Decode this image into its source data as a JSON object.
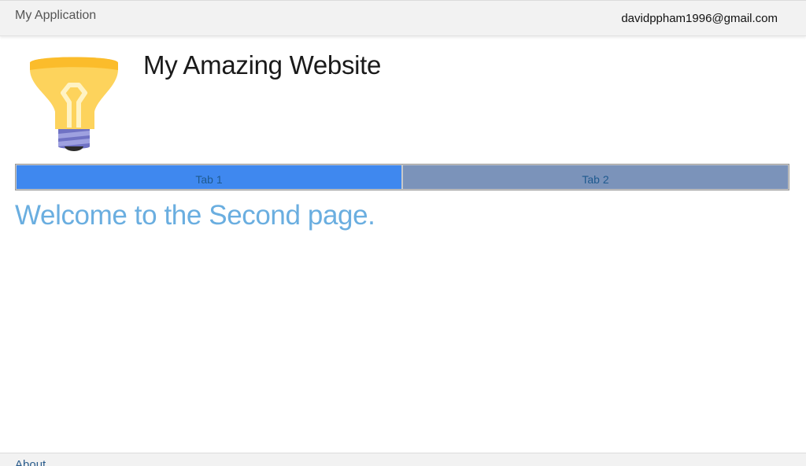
{
  "navbar": {
    "app_title": "My Application",
    "user_email": "davidppham1996@gmail.com"
  },
  "header": {
    "logo_icon": "lightbulb-icon",
    "site_title": "My Amazing Website"
  },
  "tabs": [
    {
      "label": "Tab 1",
      "active": true
    },
    {
      "label": "Tab 2",
      "active": false
    }
  ],
  "main": {
    "heading": "Welcome to the Second page."
  },
  "footer": {
    "link_label": "About"
  },
  "colors": {
    "active_tab": "#3f88ef",
    "inactive_tab": "#7b93ba",
    "heading": "#6aaee0",
    "bulb_top": "#fbbc2b",
    "bulb_body": "#fdd35c",
    "bulb_base": "#6f72c4"
  }
}
